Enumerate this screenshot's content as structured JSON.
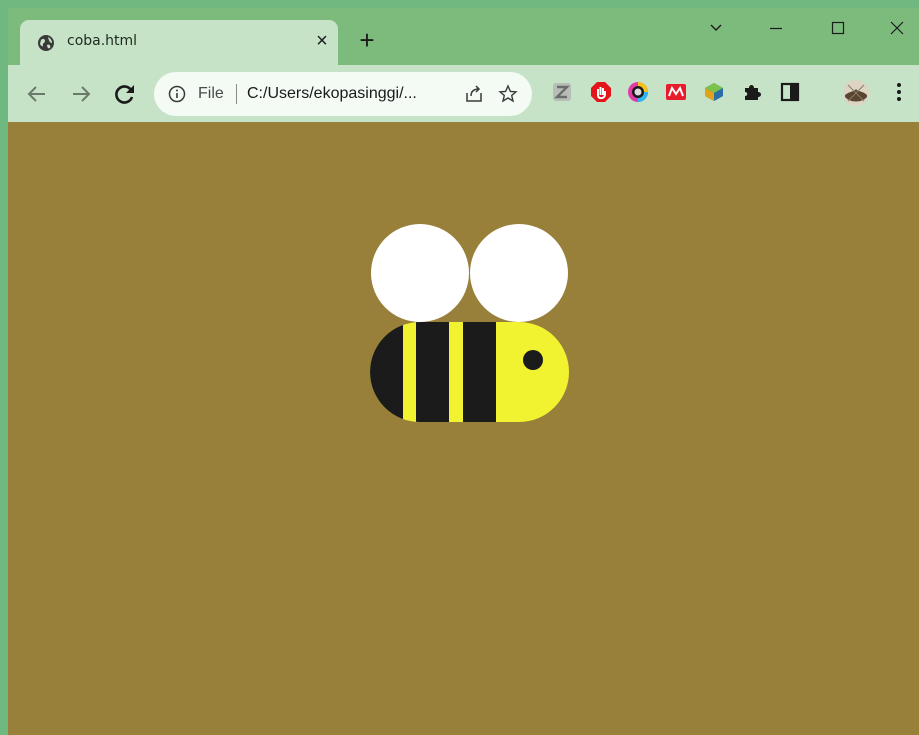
{
  "tab": {
    "title": "coba.html",
    "close_symbol": "×",
    "favicon_icon": "globe-icon"
  },
  "new_tab_symbol": "+",
  "window_controls": [
    "chevron-down-icon",
    "minimize-icon",
    "maximize-icon",
    "close-icon"
  ],
  "toolbar": {
    "back_icon": "arrow-left-icon",
    "forward_icon": "arrow-right-icon",
    "reload_icon": "reload-icon"
  },
  "omnibox": {
    "scheme": "File",
    "url": "C:/Users/ekopasinggi/..."
  },
  "extensions": [
    "z-extension-icon",
    "adblock-icon",
    "color-picker-icon",
    "mendeley-icon",
    "globe-extension-icon",
    "puzzle-icon",
    "side-panel-icon",
    "profile-avatar-icon",
    "kebab-menu-icon"
  ],
  "colors": {
    "titlebar": "#7dbb7d",
    "toolbar": "#c6e3c8",
    "page_background": "#98803a",
    "bee_wing": "#ffffff",
    "bee_body": "#f1f230",
    "bee_stripe": "#1b1b1b"
  }
}
